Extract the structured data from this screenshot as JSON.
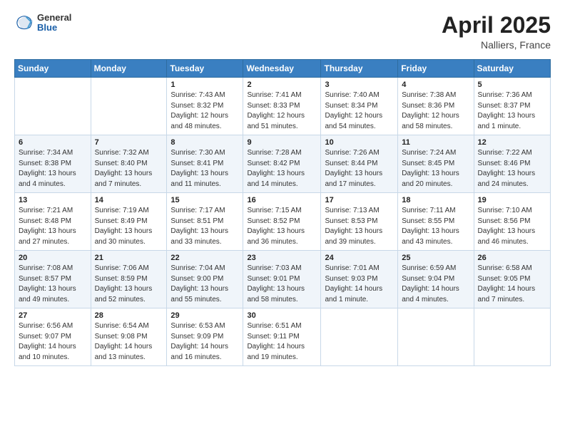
{
  "header": {
    "logo_text_line1": "General",
    "logo_text_line2": "Blue",
    "month_year": "April 2025",
    "location": "Nalliers, France"
  },
  "days_of_week": [
    "Sunday",
    "Monday",
    "Tuesday",
    "Wednesday",
    "Thursday",
    "Friday",
    "Saturday"
  ],
  "weeks": [
    [
      null,
      null,
      {
        "day": "1",
        "sunrise": "7:43 AM",
        "sunset": "8:32 PM",
        "daylight": "12 hours and 48 minutes."
      },
      {
        "day": "2",
        "sunrise": "7:41 AM",
        "sunset": "8:33 PM",
        "daylight": "12 hours and 51 minutes."
      },
      {
        "day": "3",
        "sunrise": "7:40 AM",
        "sunset": "8:34 PM",
        "daylight": "12 hours and 54 minutes."
      },
      {
        "day": "4",
        "sunrise": "7:38 AM",
        "sunset": "8:36 PM",
        "daylight": "12 hours and 58 minutes."
      },
      {
        "day": "5",
        "sunrise": "7:36 AM",
        "sunset": "8:37 PM",
        "daylight": "13 hours and 1 minute."
      }
    ],
    [
      {
        "day": "6",
        "sunrise": "7:34 AM",
        "sunset": "8:38 PM",
        "daylight": "13 hours and 4 minutes."
      },
      {
        "day": "7",
        "sunrise": "7:32 AM",
        "sunset": "8:40 PM",
        "daylight": "13 hours and 7 minutes."
      },
      {
        "day": "8",
        "sunrise": "7:30 AM",
        "sunset": "8:41 PM",
        "daylight": "13 hours and 11 minutes."
      },
      {
        "day": "9",
        "sunrise": "7:28 AM",
        "sunset": "8:42 PM",
        "daylight": "13 hours and 14 minutes."
      },
      {
        "day": "10",
        "sunrise": "7:26 AM",
        "sunset": "8:44 PM",
        "daylight": "13 hours and 17 minutes."
      },
      {
        "day": "11",
        "sunrise": "7:24 AM",
        "sunset": "8:45 PM",
        "daylight": "13 hours and 20 minutes."
      },
      {
        "day": "12",
        "sunrise": "7:22 AM",
        "sunset": "8:46 PM",
        "daylight": "13 hours and 24 minutes."
      }
    ],
    [
      {
        "day": "13",
        "sunrise": "7:21 AM",
        "sunset": "8:48 PM",
        "daylight": "13 hours and 27 minutes."
      },
      {
        "day": "14",
        "sunrise": "7:19 AM",
        "sunset": "8:49 PM",
        "daylight": "13 hours and 30 minutes."
      },
      {
        "day": "15",
        "sunrise": "7:17 AM",
        "sunset": "8:51 PM",
        "daylight": "13 hours and 33 minutes."
      },
      {
        "day": "16",
        "sunrise": "7:15 AM",
        "sunset": "8:52 PM",
        "daylight": "13 hours and 36 minutes."
      },
      {
        "day": "17",
        "sunrise": "7:13 AM",
        "sunset": "8:53 PM",
        "daylight": "13 hours and 39 minutes."
      },
      {
        "day": "18",
        "sunrise": "7:11 AM",
        "sunset": "8:55 PM",
        "daylight": "13 hours and 43 minutes."
      },
      {
        "day": "19",
        "sunrise": "7:10 AM",
        "sunset": "8:56 PM",
        "daylight": "13 hours and 46 minutes."
      }
    ],
    [
      {
        "day": "20",
        "sunrise": "7:08 AM",
        "sunset": "8:57 PM",
        "daylight": "13 hours and 49 minutes."
      },
      {
        "day": "21",
        "sunrise": "7:06 AM",
        "sunset": "8:59 PM",
        "daylight": "13 hours and 52 minutes."
      },
      {
        "day": "22",
        "sunrise": "7:04 AM",
        "sunset": "9:00 PM",
        "daylight": "13 hours and 55 minutes."
      },
      {
        "day": "23",
        "sunrise": "7:03 AM",
        "sunset": "9:01 PM",
        "daylight": "13 hours and 58 minutes."
      },
      {
        "day": "24",
        "sunrise": "7:01 AM",
        "sunset": "9:03 PM",
        "daylight": "14 hours and 1 minute."
      },
      {
        "day": "25",
        "sunrise": "6:59 AM",
        "sunset": "9:04 PM",
        "daylight": "14 hours and 4 minutes."
      },
      {
        "day": "26",
        "sunrise": "6:58 AM",
        "sunset": "9:05 PM",
        "daylight": "14 hours and 7 minutes."
      }
    ],
    [
      {
        "day": "27",
        "sunrise": "6:56 AM",
        "sunset": "9:07 PM",
        "daylight": "14 hours and 10 minutes."
      },
      {
        "day": "28",
        "sunrise": "6:54 AM",
        "sunset": "9:08 PM",
        "daylight": "14 hours and 13 minutes."
      },
      {
        "day": "29",
        "sunrise": "6:53 AM",
        "sunset": "9:09 PM",
        "daylight": "14 hours and 16 minutes."
      },
      {
        "day": "30",
        "sunrise": "6:51 AM",
        "sunset": "9:11 PM",
        "daylight": "14 hours and 19 minutes."
      },
      null,
      null,
      null
    ]
  ],
  "labels": {
    "sunrise_label": "Sunrise:",
    "sunset_label": "Sunset:",
    "daylight_label": "Daylight:"
  }
}
